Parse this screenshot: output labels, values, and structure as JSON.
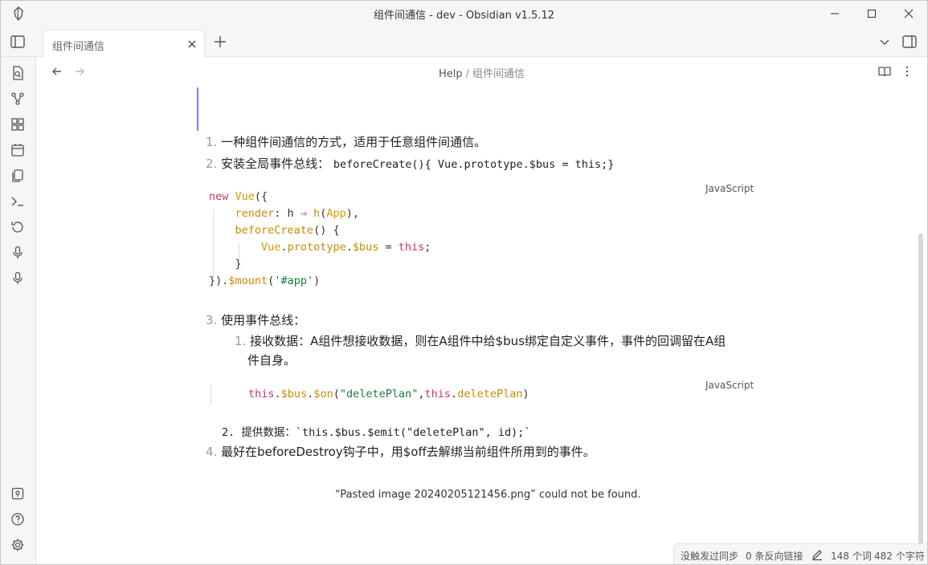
{
  "window": {
    "title": "组件间通信 - dev - Obsidian v1.5.12"
  },
  "tabs": [
    {
      "label": "组件间通信"
    }
  ],
  "breadcrumb": {
    "parent": "Help",
    "separator": "/",
    "current": "组件间通信"
  },
  "content": {
    "item1_num": "1.",
    "item1_text": "一种组件间通信的方式，适用于任意组件间通信。",
    "item2_num": "2.",
    "item2_text": "安装全局事件总线：",
    "item2_code": "beforeCreate(){ Vue.prototype.$bus = this;}",
    "code1_lang": "JavaScript",
    "code1_lines": [
      [
        [
          "kw",
          "new "
        ],
        [
          "cls",
          "Vue"
        ],
        [
          "punc",
          "({"
        ]
      ],
      [
        [
          "punc",
          "    "
        ],
        [
          "fn",
          "render"
        ],
        [
          "punc",
          ": h "
        ],
        [
          "kw",
          "⇒"
        ],
        [
          "punc",
          " "
        ],
        [
          "fn",
          "h"
        ],
        [
          "punc",
          "("
        ],
        [
          "cls",
          "App"
        ],
        [
          "punc",
          "),"
        ]
      ],
      [
        [
          "punc",
          "    "
        ],
        [
          "fn",
          "beforeCreate"
        ],
        [
          "punc",
          "() {"
        ]
      ],
      [
        [
          "punc",
          "        "
        ],
        [
          "cls",
          "Vue"
        ],
        [
          "punc",
          "."
        ],
        [
          "fn",
          "prototype"
        ],
        [
          "punc",
          "."
        ],
        [
          "fn",
          "$bus"
        ],
        [
          "punc",
          " = "
        ],
        [
          "kw",
          "this"
        ],
        [
          "punc",
          ";"
        ]
      ],
      [
        [
          "punc",
          "    }"
        ]
      ],
      [
        [
          "punc",
          "})."
        ],
        [
          "fn",
          "$mount"
        ],
        [
          "punc",
          "("
        ],
        [
          "str",
          "'#app'"
        ],
        [
          "punc",
          ")"
        ]
      ]
    ],
    "item3_num": "3.",
    "item3_text": "使用事件总线：",
    "sub1_num": "1.",
    "sub1_text_a": "接收数据：A组件想接收数据，则在A组件中给$bus绑定自定义事件，事件的回调留在A组",
    "sub1_text_b": "件自身。",
    "code2_lang": "JavaScript",
    "code2_lines": [
      [
        [
          "kw",
          "this"
        ],
        [
          "punc",
          "."
        ],
        [
          "fn",
          "$bus"
        ],
        [
          "punc",
          "."
        ],
        [
          "fn",
          "$on"
        ],
        [
          "punc",
          "("
        ],
        [
          "str",
          "\"deletePlan\""
        ],
        [
          "punc",
          ","
        ],
        [
          "kw",
          "this"
        ],
        [
          "punc",
          "."
        ],
        [
          "fn",
          "deletePlan"
        ],
        [
          "punc",
          ")"
        ]
      ]
    ],
    "sub2_text": "  2. 提供数据：`this.$bus.$emit(\"deletePlan\", id);`",
    "item4_num": "4.",
    "item4_text": "最好在beforeDestroy钩子中，用$off去解绑当前组件所用到的事件。",
    "missing_image": "“Pasted image 20240205121456.png” could not be found."
  },
  "status": {
    "sync": "没触发过同步",
    "backlinks": "0 条反向链接",
    "words": "148 个词",
    "chars": "482 个字符"
  },
  "colors": {
    "accent": "#9b6ee8",
    "keyword": "#c8336e",
    "function": "#c98a00",
    "string": "#1c7a3e"
  }
}
